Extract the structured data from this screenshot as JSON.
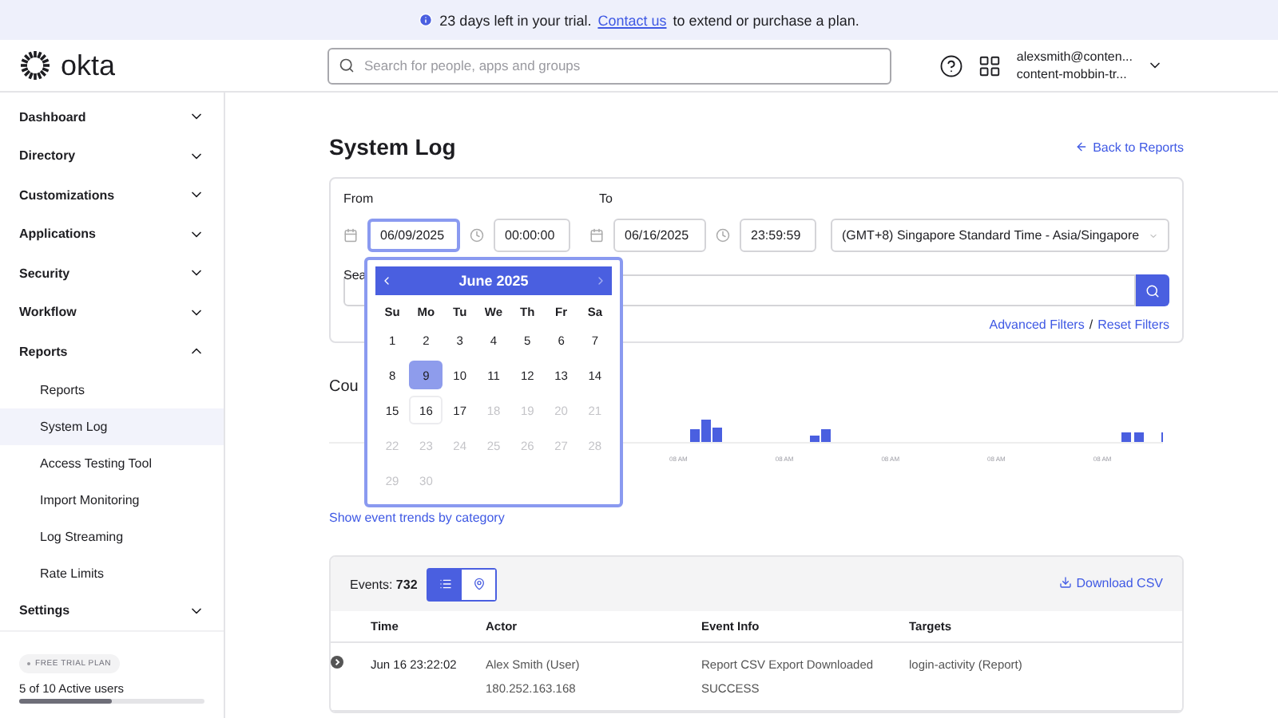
{
  "banner": {
    "text": "23 days left in your trial.",
    "link": "Contact us",
    "rest": "to extend or purchase a plan."
  },
  "header": {
    "logo": "okta",
    "search_placeholder": "Search for people, apps and groups",
    "user_email": "alexsmith@conten...",
    "user_org": "content-mobbin-tr..."
  },
  "sidebar": {
    "items": [
      {
        "label": "Dashboard",
        "expanded": false
      },
      {
        "label": "Directory",
        "expanded": false
      },
      {
        "label": "Customizations",
        "expanded": false
      },
      {
        "label": "Applications",
        "expanded": false
      },
      {
        "label": "Security",
        "expanded": false
      },
      {
        "label": "Workflow",
        "expanded": false
      },
      {
        "label": "Reports",
        "expanded": true,
        "children": [
          {
            "label": "Reports",
            "selected": false
          },
          {
            "label": "System Log",
            "selected": true
          },
          {
            "label": "Access Testing Tool",
            "selected": false
          },
          {
            "label": "Import Monitoring",
            "selected": false
          },
          {
            "label": "Log Streaming",
            "selected": false
          },
          {
            "label": "Rate Limits",
            "selected": false
          }
        ]
      },
      {
        "label": "Settings",
        "expanded": false
      }
    ],
    "plan_badge": "FREE TRIAL PLAN",
    "users": {
      "text": "5 of 10 Active users",
      "level": 0.5
    }
  },
  "page": {
    "title": "System Log",
    "back_link": "Back to Reports"
  },
  "filters": {
    "from_label": "From",
    "from_date": "06/09/2025",
    "from_time": "00:00:00",
    "to_label": "To",
    "to_date": "06/16/2025",
    "to_time": "23:59:59",
    "timezone": "(GMT+8) Singapore Standard Time - Asia/Singapore",
    "search_label": "Sea",
    "advanced_link": "Advanced Filters",
    "separator": "/",
    "reset_link": "Reset Filters"
  },
  "calendar": {
    "month": "June 2025",
    "weekdays": [
      "Su",
      "Mo",
      "Tu",
      "We",
      "Th",
      "Fr",
      "Sa"
    ],
    "days": [
      {
        "label": "1",
        "selected": false,
        "today": false,
        "disabled": false
      },
      {
        "label": "2",
        "selected": false,
        "today": false,
        "disabled": false
      },
      {
        "label": "3",
        "selected": false,
        "today": false,
        "disabled": false
      },
      {
        "label": "4",
        "selected": false,
        "today": false,
        "disabled": false
      },
      {
        "label": "5",
        "selected": false,
        "today": false,
        "disabled": false
      },
      {
        "label": "6",
        "selected": false,
        "today": false,
        "disabled": false
      },
      {
        "label": "7",
        "selected": false,
        "today": false,
        "disabled": false
      },
      {
        "label": "8",
        "selected": false,
        "today": false,
        "disabled": false
      },
      {
        "label": "9",
        "selected": true,
        "today": false,
        "disabled": false
      },
      {
        "label": "10",
        "selected": false,
        "today": false,
        "disabled": false
      },
      {
        "label": "11",
        "selected": false,
        "today": false,
        "disabled": false
      },
      {
        "label": "12",
        "selected": false,
        "today": false,
        "disabled": false
      },
      {
        "label": "13",
        "selected": false,
        "today": false,
        "disabled": false
      },
      {
        "label": "14",
        "selected": false,
        "today": false,
        "disabled": false
      },
      {
        "label": "15",
        "selected": false,
        "today": false,
        "disabled": false
      },
      {
        "label": "16",
        "selected": false,
        "today": true,
        "disabled": false
      },
      {
        "label": "17",
        "selected": false,
        "today": false,
        "disabled": false
      },
      {
        "label": "18",
        "selected": false,
        "today": false,
        "disabled": true
      },
      {
        "label": "19",
        "selected": false,
        "today": false,
        "disabled": true
      },
      {
        "label": "20",
        "selected": false,
        "today": false,
        "disabled": true
      },
      {
        "label": "21",
        "selected": false,
        "today": false,
        "disabled": true
      },
      {
        "label": "22",
        "selected": false,
        "today": false,
        "disabled": true
      },
      {
        "label": "23",
        "selected": false,
        "today": false,
        "disabled": true
      },
      {
        "label": "24",
        "selected": false,
        "today": false,
        "disabled": true
      },
      {
        "label": "25",
        "selected": false,
        "today": false,
        "disabled": true
      },
      {
        "label": "26",
        "selected": false,
        "today": false,
        "disabled": true
      },
      {
        "label": "27",
        "selected": false,
        "today": false,
        "disabled": true
      },
      {
        "label": "28",
        "selected": false,
        "today": false,
        "disabled": true
      },
      {
        "label": "29",
        "selected": false,
        "today": false,
        "disabled": true
      },
      {
        "label": "30",
        "selected": false,
        "today": false,
        "disabled": true
      }
    ]
  },
  "count_section": {
    "title": "Cou",
    "tick_labels": [
      "08 AM",
      "08 AM",
      "08 AM",
      "08 AM",
      "08 AM"
    ],
    "trends_link": "Show event trends by category"
  },
  "events": {
    "label": "Events:",
    "count": "732",
    "views": [
      {
        "kind": "list",
        "selected": true
      },
      {
        "kind": "map",
        "selected": false
      }
    ],
    "download": "Download CSV",
    "columns": [
      "Time",
      "Actor",
      "Event Info",
      "Targets"
    ],
    "rows": [
      {
        "time": "Jun 16 23:22:02",
        "actor": "Alex Smith (User)",
        "ip": "180.252.163.168",
        "event": "Report CSV Export Downloaded",
        "result": "SUCCESS",
        "target": "login-activity",
        "target_type": "(Report)"
      }
    ]
  }
}
